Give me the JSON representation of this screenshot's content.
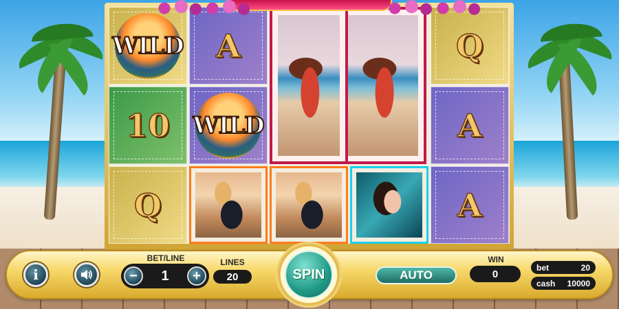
{
  "reels": {
    "row1": [
      {
        "type": "wild",
        "label": "WILD"
      },
      {
        "type": "letter",
        "label": "A",
        "color": "#7a72c9"
      },
      {
        "type": "photo",
        "label": "woman-red-swimsuit-lounger"
      },
      {
        "type": "photo",
        "label": "woman-red-swimsuit-lounger"
      },
      {
        "type": "letter",
        "label": "Q",
        "color": "#c9b14a"
      }
    ],
    "symbols": {
      "r0c0": "WILD",
      "r0c1": "A",
      "r0c4": "Q",
      "r1c0": "10",
      "r1c1": "WILD",
      "r1c4": "A",
      "r2c0": "Q",
      "r2c4": "A"
    }
  },
  "controls": {
    "info_icon": "i",
    "sound_icon": "speaker-icon",
    "bet_line_label": "BET/LINE",
    "bet_line_value": "1",
    "minus": "−",
    "plus": "+",
    "lines_label": "LINES",
    "lines_value": "20",
    "spin_label": "SPIN",
    "auto_label": "AUTO",
    "win_label": "WIN",
    "win_value": "0",
    "bet_label": "bet",
    "bet_value": "20",
    "cash_label": "cash",
    "cash_value": "10000"
  },
  "colors": {
    "frame_gold": "#d0a535",
    "frame_pink": "#c7124b",
    "spin_teal": "#1f9a86"
  }
}
